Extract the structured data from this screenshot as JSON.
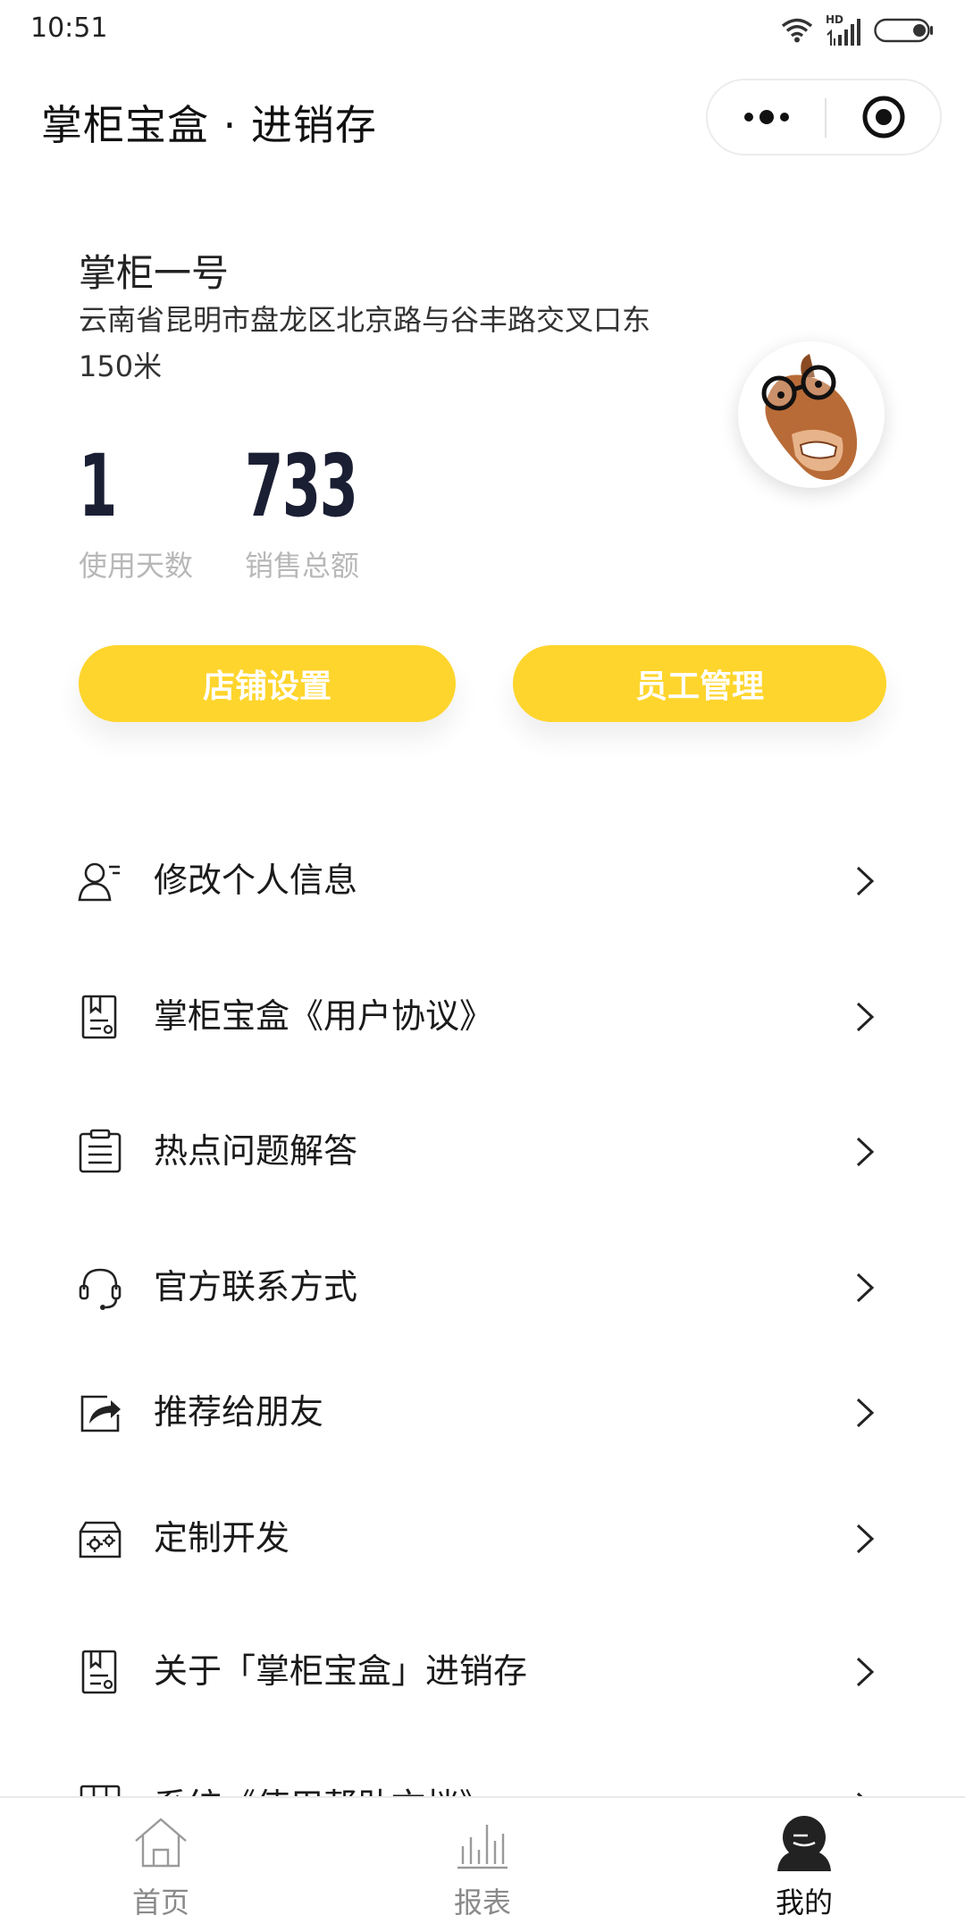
{
  "status_bar": {
    "time": "10:51",
    "network_label": "HD"
  },
  "header": {
    "title": "掌柜宝盒 · 进销存"
  },
  "profile": {
    "shop_name": "掌柜一号",
    "address": "云南省昆明市盘龙区北京路与谷丰路交叉口东150米"
  },
  "stats": [
    {
      "value": "1",
      "label": "使用天数"
    },
    {
      "value": "733",
      "label": "销售总额"
    }
  ],
  "actions": {
    "store_settings": "店铺设置",
    "staff_management": "员工管理"
  },
  "menu": [
    {
      "icon": "user-edit-icon",
      "label": "修改个人信息"
    },
    {
      "icon": "agreement-doc-icon",
      "label": "掌柜宝盒《用户协议》"
    },
    {
      "icon": "faq-list-icon",
      "label": "热点问题解答"
    },
    {
      "icon": "headset-icon",
      "label": "官方联系方式"
    },
    {
      "icon": "share-icon",
      "label": "推荐给朋友"
    },
    {
      "icon": "custom-dev-icon",
      "label": "定制开发"
    },
    {
      "icon": "about-doc-icon",
      "label": "关于「掌柜宝盒」进销存"
    },
    {
      "icon": "help-doc-icon",
      "label": "系统《使用帮助文档》"
    }
  ],
  "tabs": [
    {
      "icon": "home-icon",
      "label": "首页",
      "active": false
    },
    {
      "icon": "chart-icon",
      "label": "报表",
      "active": false
    },
    {
      "icon": "profile-icon",
      "label": "我的",
      "active": true
    }
  ],
  "colors": {
    "accent": "#fed52d",
    "stat_number": "#1b1f33",
    "muted": "#b8b8b8"
  }
}
